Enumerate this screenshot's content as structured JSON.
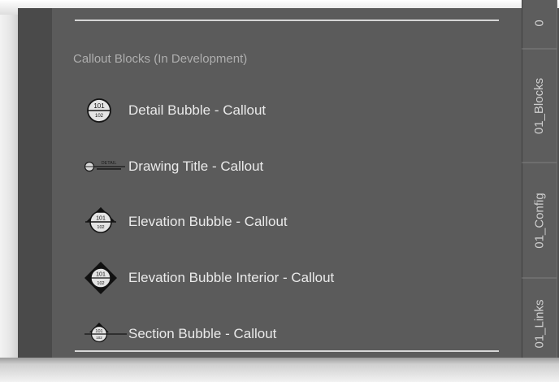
{
  "palette": {
    "panel_bg": "#5b5b5b",
    "text": "#eaeaea",
    "section_title": "#aeaeae",
    "tab_text": "#cfcfcf",
    "divider": "#d6d6d6"
  },
  "section": {
    "title": "Callout Blocks (In Development)"
  },
  "items": [
    {
      "label": "Detail Bubble - Callout",
      "icon": "detail-bubble-icon",
      "icon_text_top": "101",
      "icon_text_bottom": "102"
    },
    {
      "label": "Drawing Title - Callout",
      "icon": "drawing-title-icon",
      "icon_text_top": "DETAIL"
    },
    {
      "label": "Elevation Bubble - Callout",
      "icon": "elevation-bubble-icon",
      "icon_text_top": "101",
      "icon_text_bottom": "102"
    },
    {
      "label": "Elevation Bubble Interior - Callout",
      "icon": "elevation-bubble-interior-icon",
      "icon_text_top": "101",
      "icon_text_bottom": "102"
    },
    {
      "label": "Section Bubble - Callout",
      "icon": "section-bubble-icon",
      "icon_text_top": "101",
      "icon_text_bottom": "102"
    }
  ],
  "tabs": [
    {
      "label": "0"
    },
    {
      "label": "01_Blocks"
    },
    {
      "label": "01_Config"
    },
    {
      "label": "01_Links"
    }
  ]
}
